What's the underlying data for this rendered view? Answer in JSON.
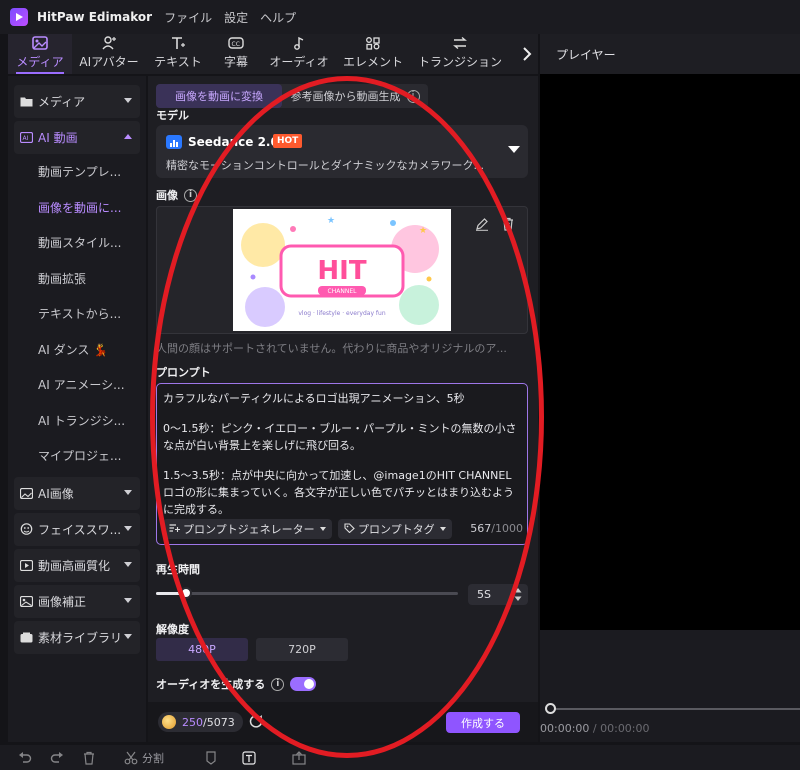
{
  "app": {
    "title": "HitPaw Edimakor"
  },
  "menu": [
    "ファイル",
    "設定",
    "ヘルプ"
  ],
  "tool_tabs": [
    {
      "label": "メディア",
      "icon": "media-icon"
    },
    {
      "label": "AIアバター",
      "icon": "avatar-icon"
    },
    {
      "label": "テキスト",
      "icon": "text-icon"
    },
    {
      "label": "字幕",
      "icon": "caption-icon"
    },
    {
      "label": "オーディオ",
      "icon": "audio-icon"
    },
    {
      "label": "エレメント",
      "icon": "element-icon"
    },
    {
      "label": "トランジション",
      "icon": "transition-icon"
    }
  ],
  "player": {
    "title": "プレイヤー",
    "current_time": "00:00:00",
    "separator": " / ",
    "total_time": "00:00:00"
  },
  "sidebar": {
    "media": "メディア",
    "ai_video": "AI 動画",
    "ai_video_items": [
      "動画テンプレ...",
      "画像を動画に...",
      "動画スタイル...",
      "動画拡張",
      "テキストから...",
      "AI ダンス 💃",
      "AI アニメーシ...",
      "AI トランジシ...",
      "マイプロジェ..."
    ],
    "groups": [
      "AI画像",
      "フェイススワ...",
      "動画高画質化",
      "画像補正",
      "素材ライブラリ"
    ]
  },
  "panel": {
    "subtabs": {
      "active": "画像を動画に変換",
      "other": "参考画像から動画生成"
    },
    "model_label": "モデル",
    "model": {
      "name": "Seedance 2.0",
      "badge": "HOT",
      "description": "精密なモーションコントロールとダイナミックなカメラワーク..."
    },
    "image_label": "画像",
    "image_note": "人間の顔はサポートされていません。代わりに商品やオリジナルのア...",
    "thumbnail": {
      "logo": "HIT",
      "channel": "CHANNEL",
      "tagline": "vlog · lifestyle · everyday fun"
    },
    "prompt_label": "プロンプト",
    "prompt_paragraphs": [
      "カラフルなパーティクルによるロゴ出現アニメーション、5秒",
      "0～1.5秒：ピンク・イエロー・ブルー・パープル・ミントの無数の小さな点が白い背景上を楽しげに飛び回る。",
      "1.5～3.5秒：点が中央に向かって加速し、@image1のHIT CHANNELロゴの形に集まっていく。各文字が正しい色でパチッとはまり込むように完成する。"
    ],
    "prompt_generator": "プロンプトジェネレーター",
    "prompt_tag": "プロンプトタグ",
    "char_count": "567",
    "char_max": "/1000",
    "duration_label": "再生時間",
    "duration_value": "5S",
    "duration_fraction": 0.1,
    "resolution_label": "解像度",
    "resolution_options": [
      "480P",
      "720P"
    ],
    "audio_label": "オーディオを生成する",
    "audio_enabled": true,
    "credits_used": "250",
    "credits_total": "/5073",
    "create_button": "作成する"
  },
  "bottombar": {
    "split_label": "分割"
  },
  "colors": {
    "accent": "#9b6dff",
    "annotation": "#e21c23",
    "hot_badge": "#ff5a2e"
  }
}
